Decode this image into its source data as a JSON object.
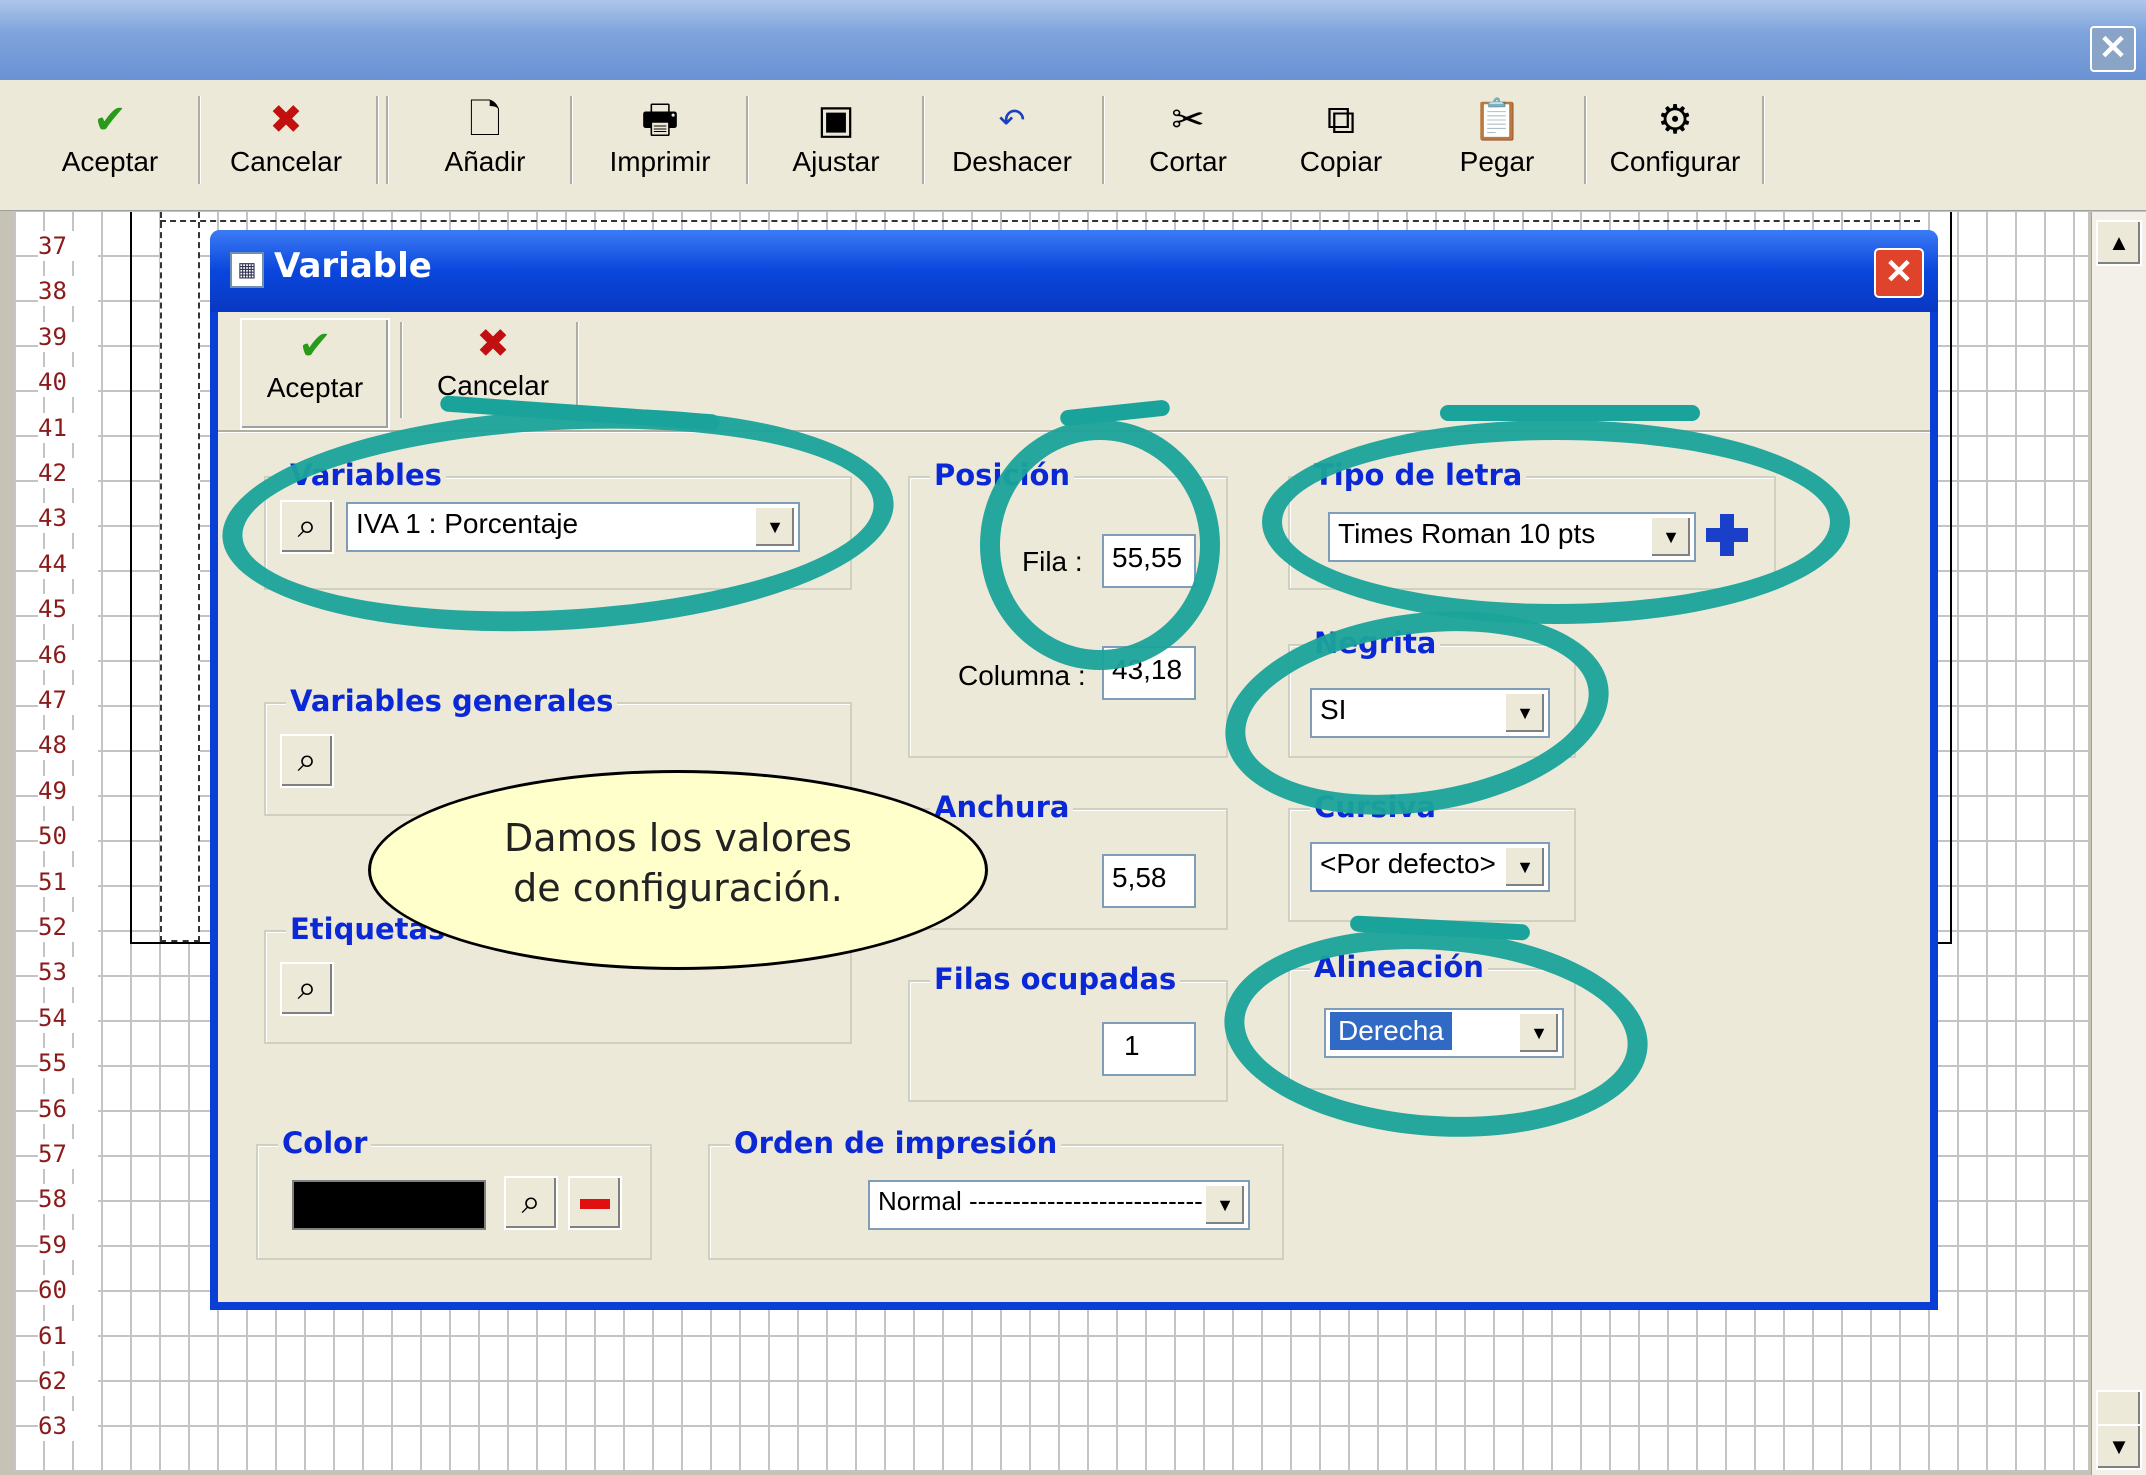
{
  "toolbar": {
    "items": [
      {
        "label": "Aceptar",
        "icon": "check-icon"
      },
      {
        "label": "Cancelar",
        "icon": "x-icon"
      },
      {
        "label": "Añadir",
        "icon": "new-page-icon"
      },
      {
        "label": "Imprimir",
        "icon": "printer-icon"
      },
      {
        "label": "Ajustar",
        "icon": "monitor-icon"
      },
      {
        "label": "Deshacer",
        "icon": "undo-icon"
      },
      {
        "label": "Cortar",
        "icon": "scissors-icon"
      },
      {
        "label": "Copiar",
        "icon": "copy-icon"
      },
      {
        "label": "Pegar",
        "icon": "paste-icon"
      },
      {
        "label": "Configurar",
        "icon": "gear-icon"
      }
    ]
  },
  "rows": [
    "37",
    "38",
    "39",
    "40",
    "41",
    "42",
    "43",
    "44",
    "45",
    "46",
    "47",
    "48",
    "49",
    "50",
    "51",
    "52",
    "53",
    "54",
    "55",
    "56",
    "57",
    "58",
    "59",
    "60",
    "61",
    "62",
    "63"
  ],
  "dialog": {
    "title": "Variable",
    "toolbar": {
      "accept": "Aceptar",
      "cancel": "Cancelar"
    },
    "variables": {
      "label": "Variables",
      "value": "IVA 1 : Porcentaje"
    },
    "variables_generales": {
      "label": "Variables generales"
    },
    "etiquetas": {
      "label": "Etiquetas"
    },
    "posicion": {
      "label": "Posición",
      "fila_label": "Fila :",
      "fila": "55,55",
      "columna_label": "Columna :",
      "columna": "43,18"
    },
    "anchura": {
      "label": "Anchura",
      "value": "5,58"
    },
    "filas_ocupadas": {
      "label": "Filas ocupadas",
      "value": "1"
    },
    "tipo_letra": {
      "label": "Tipo de letra",
      "value": "Times Roman 10 pts"
    },
    "negrita": {
      "label": "Negrita",
      "value": "SI"
    },
    "cursiva": {
      "label": "Cursiva",
      "value": "<Por defecto>"
    },
    "alineacion": {
      "label": "Alineación",
      "value": "Derecha"
    },
    "color": {
      "label": "Color",
      "swatch": "#000000"
    },
    "orden": {
      "label": "Orden de impresión",
      "value": "Normal ---------------------------"
    }
  },
  "callout": {
    "line1": "Damos los valores",
    "line2": "de configuración."
  },
  "colors": {
    "highlight": "#1aa39a",
    "label_blue": "#0a28d6",
    "row_number": "#8b1a1a"
  }
}
